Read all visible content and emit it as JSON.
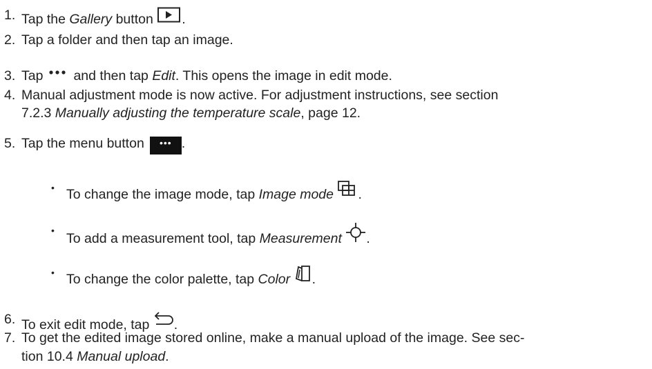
{
  "steps": [
    {
      "num": "1.",
      "pre": "Tap the ",
      "em": "Gallery",
      "post": " button",
      "icon": "gallery-play-icon",
      "end": "."
    },
    {
      "num": "2.",
      "text": "Tap a folder and then tap an image."
    },
    {
      "num": "3.",
      "pre": "Tap",
      "icon": "more-dots-icon",
      "mid": "and then tap ",
      "em": "Edit",
      "post": ". This opens the image in edit mode."
    },
    {
      "num": "4.",
      "line1": "Manual adjustment mode is now active. For adjustment instructions, see section",
      "line2_pre": "7.2.3 ",
      "line2_em": "Manually adjusting the temperature scale",
      "line2_post": ", page 12."
    },
    {
      "num": "5.",
      "pre": "Tap the menu button",
      "icon": "menu-button-icon",
      "icon_text": "•••",
      "end": "."
    },
    {
      "num": "6.",
      "pre": "To exit edit mode, tap",
      "icon": "back-arrow-icon",
      "end": "."
    },
    {
      "num": "7.",
      "line1": "To get the edited image stored online, make a manual upload of the image. See sec-",
      "line2_pre": "tion 10.4 ",
      "line2_em": "Manual upload",
      "line2_post": "."
    }
  ],
  "bullets": [
    {
      "mark": "•",
      "pre": "To change the image mode, tap ",
      "em": "Image mode",
      "icon": "image-mode-icon",
      "end": "."
    },
    {
      "mark": "•",
      "pre": "To add a measurement tool, tap ",
      "em": "Measurement",
      "icon": "measurement-crosshair-icon",
      "end": "."
    },
    {
      "mark": "•",
      "pre": "To change the color palette, tap ",
      "em": "Color",
      "icon": "color-palette-icon",
      "end": "."
    }
  ]
}
